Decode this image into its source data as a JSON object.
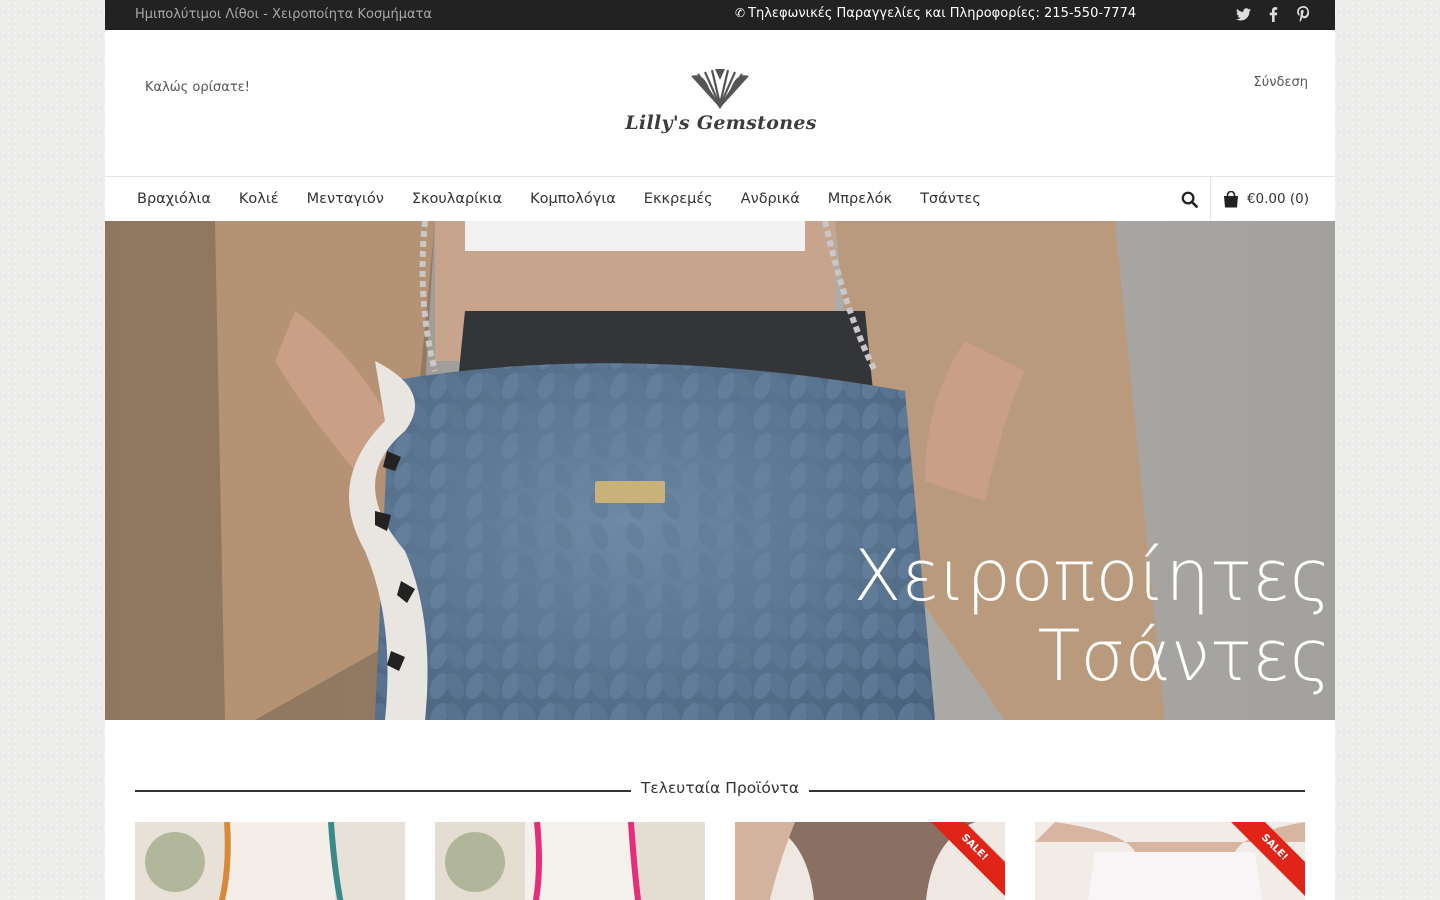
{
  "topbar": {
    "tagline": "Ημιπολύτιμοι Λίθοι - Χειροποίητα Κοσμήματα",
    "phone_text": "Τηλεφωνικές Παραγγελίες και Πληροφορίες: 215-550-7774",
    "phone_icon": "phone-icon",
    "social": [
      "twitter-icon",
      "facebook-icon",
      "pinterest-icon"
    ]
  },
  "header": {
    "welcome": "Καλώς ορίσατε!",
    "login": "Σύνδεση",
    "logo_text": "Lilly's Gemstones"
  },
  "nav": {
    "items": [
      "Βραχιόλια",
      "Κολιέ",
      "Μενταγιόν",
      "Σκουλαρίκια",
      "Κομπολόγια",
      "Εκκρεμές",
      "Ανδρικά",
      "Μπρελόκ",
      "Τσάντες"
    ],
    "cart": "€0.00 (0)"
  },
  "hero": {
    "line1": "Χειροποίητες",
    "line2": "Τσάντες"
  },
  "latest": {
    "title": "Τελευταία Προϊόντα",
    "products": [
      {
        "sale": false
      },
      {
        "sale": false
      },
      {
        "sale": true,
        "badge": "SALE!"
      },
      {
        "sale": true,
        "badge": "SALE!"
      }
    ]
  },
  "colors": {
    "topbar_bg": "#222222",
    "sale": "#e02418",
    "bag_blue": "#5e7a95"
  }
}
